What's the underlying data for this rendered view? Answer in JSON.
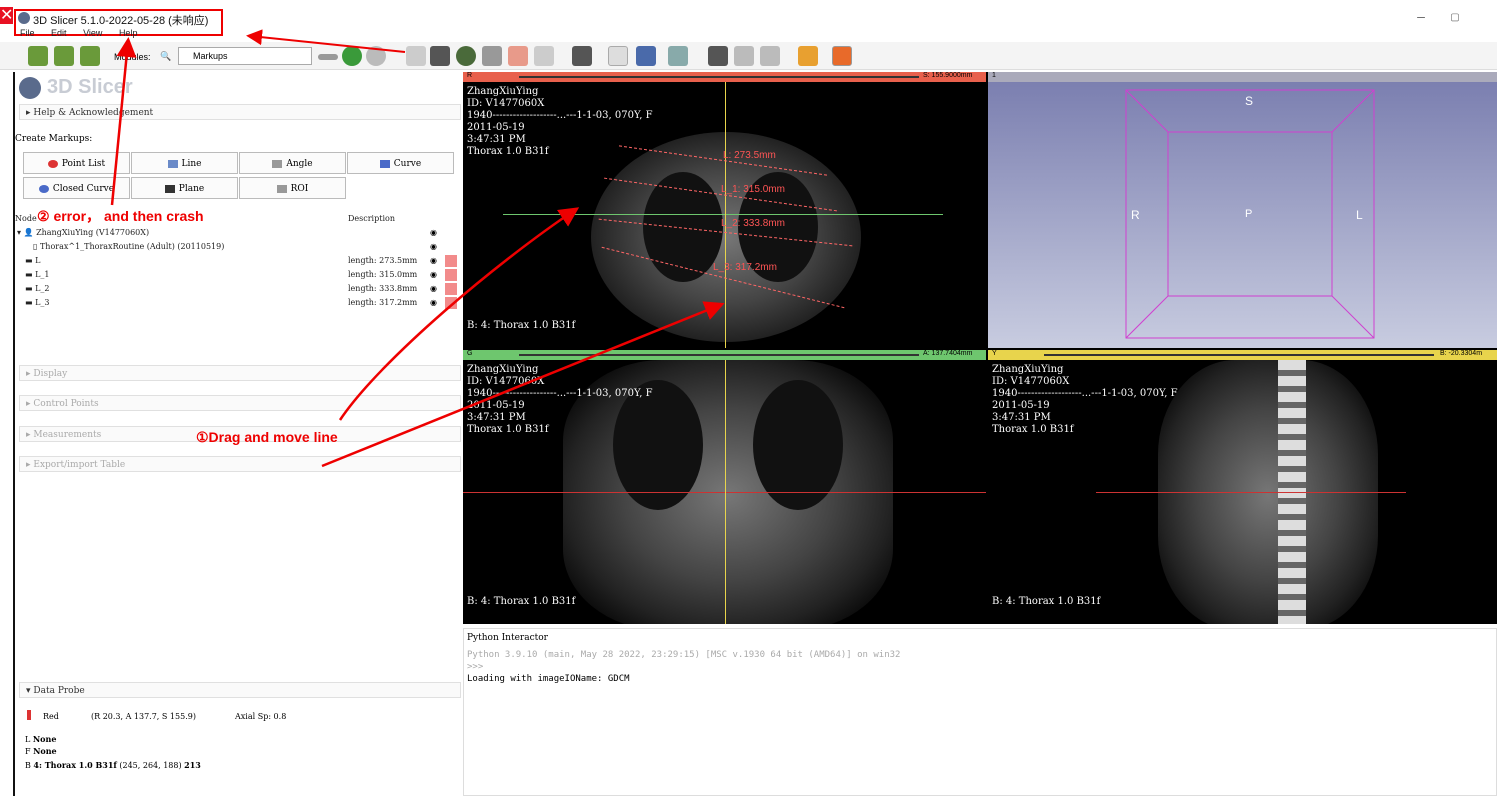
{
  "window": {
    "title": "3D Slicer 5.1.0-2022-05-28 (未响应)"
  },
  "menu": [
    "File",
    "Edit",
    "View",
    "Help"
  ],
  "toolbar": {
    "modules_label": "Modules:",
    "module_selected": "Markups"
  },
  "left": {
    "logo": "3D Slicer",
    "help_section": "Help & Acknowledgement",
    "create_label": "Create Markups:",
    "buttons": [
      "Point List",
      "Line",
      "Angle",
      "Curve",
      "Closed Curve",
      "Plane",
      "ROI"
    ],
    "tree_headers": [
      "Node",
      "Description"
    ],
    "patient": "ZhangXiuYing (V1477060X)",
    "study": "Thorax^1_ThoraxRoutine (Adult) (20110519)",
    "nodes": [
      {
        "name": "L",
        "desc": "length: 273.5mm"
      },
      {
        "name": "L_1",
        "desc": "length: 315.0mm"
      },
      {
        "name": "L_2",
        "desc": "length: 333.8mm"
      },
      {
        "name": "L_3",
        "desc": "length: 317.2mm"
      }
    ],
    "sections": [
      "Display",
      "Control Points",
      "Measurements",
      "Export/import Table"
    ],
    "probe_title": "Data Probe",
    "probe_layer": "Red",
    "probe_coords": "(R 20.3, A 137.7, S 155.9)",
    "probe_sp": "Axial Sp: 0.8",
    "probe_L": "None",
    "probe_F": "None",
    "probe_B_name": "4: Thorax 1.0 B31f",
    "probe_B_ijk": "(245, 264, 188)",
    "probe_B_val": "213"
  },
  "views": {
    "red": {
      "letter": "R",
      "offset": "S: 155.9000mm"
    },
    "green": {
      "letter": "G",
      "offset": "A: 137.7404mm"
    },
    "yellow": {
      "letter": "Y",
      "offset": "B: -20.3304m"
    },
    "three_d": {
      "letter": "1",
      "S": "S",
      "R": "R",
      "P": "P",
      "L": "L"
    },
    "patient_lines": [
      "ZhangXiuYing",
      "ID: V1477060X",
      "1940-------------------...---1-1-03, 070Y, F",
      "2011-05-19",
      "3:47:31 PM",
      "Thorax  1.0  B31f"
    ],
    "footer": "B: 4: Thorax  1.0  B31f",
    "measures": [
      "L: 273.5mm",
      "L_1: 315.0mm",
      "L_2: 333.8mm",
      "L_3: 317.2mm"
    ]
  },
  "python": {
    "title": "Python Interactor",
    "line1": "Python 3.9.10 (main, May 28 2022, 23:29:15) [MSC v.1930 64 bit (AMD64)] on win32",
    "line2": ">>>",
    "line3": "Loading with imageIOName: GDCM"
  },
  "annotations": {
    "a1": "①Drag and move line",
    "a2": "② error， and then crash"
  },
  "colors": {
    "red_bar": "#e8604c",
    "green_bar": "#6ec66e",
    "yellow_bar": "#e8d44c",
    "annot": "#e00000"
  }
}
